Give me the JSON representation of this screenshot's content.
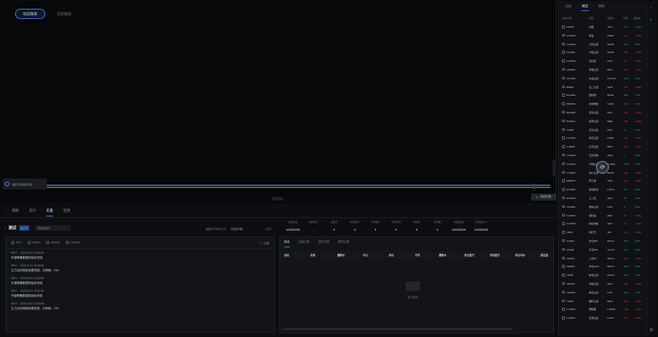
{
  "chart": {
    "tabs": [
      {
        "label": "动态图表",
        "active": true
      },
      {
        "label": "历史图表",
        "active": false
      }
    ],
    "timeline_badge": "最新行情最新时间",
    "collapse_label": "收起列表"
  },
  "bottom": {
    "tabs": [
      "策略",
      "因子",
      "实盘",
      "回测"
    ],
    "active_tab": 2,
    "strategy": {
      "name": "测试",
      "tag": "运行中",
      "select_placeholder": "请选择合约",
      "created": "创建于2026-02-01",
      "stop": "已运行0秒",
      "more": "+ 更多"
    },
    "stats": [
      {
        "k": "当前权益",
        "v": "10000000"
      },
      {
        "k": "最新盈亏",
        "v": "-"
      },
      {
        "k": "总盈亏",
        "v": "0"
      },
      {
        "k": "持仓盈亏",
        "v": "0"
      },
      {
        "k": "平仓盈亏",
        "v": "0"
      },
      {
        "k": "总手续费",
        "v": "0"
      },
      {
        "k": "手续费",
        "v": "0"
      },
      {
        "k": "总手数",
        "v": "0"
      },
      {
        "k": "初始权益",
        "v": "10000000"
      },
      {
        "k": "可用资金 ⊙",
        "v": "10000000"
      }
    ]
  },
  "log": {
    "filters": [
      "INFO",
      "WARN",
      "DEBUG",
      "ERROR"
    ],
    "clear_label": "清除",
    "items": [
      {
        "level": "INFO",
        "time": "2026-02-01 22:46:55",
        "msg": "外部策略数据初始化完成"
      },
      {
        "level": "INFO",
        "time": "2026-02-01 22:46:55",
        "msg": "主力合约映射加载完成，已映射：243"
      },
      {
        "level": "INFO",
        "time": "2026-02-01 22:46:55",
        "msg": "外部策略数据初始化完成"
      },
      {
        "level": "INFO",
        "time": "2026-02-01 22:40:56",
        "msg": "外部策略数据初始化完成"
      },
      {
        "level": "INFO",
        "time": "2026-02-01 22:40:56",
        "msg": "主力合约映射加载完成，已映射：243"
      }
    ]
  },
  "positions": {
    "tabs": [
      "持仓",
      "当前订单",
      "成交记录",
      "委托记录"
    ],
    "headers": [
      "合约",
      "买卖",
      "最新价",
      "今仓",
      "持仓",
      "可平",
      "最新价",
      "持仓盈亏",
      "浮动盈亏",
      "持仓均价",
      "保证金"
    ],
    "empty_text": "暂无数据"
  },
  "watchlist": {
    "tabs": [
      "自选",
      "期货",
      "期权"
    ],
    "active_tab": 1,
    "headers": [
      "合约代码",
      "名称",
      "最新价",
      "涨跌",
      "涨跌幅"
    ],
    "rows": [
      {
        "code": "AG603",
        "name": "白银",
        "price": "4374",
        "chg": "-12",
        "pct": "-0.3%",
        "dir": "down"
      },
      {
        "code": "AG2603",
        "name": "黄金",
        "price": "23000",
        "chg": "-11",
        "pct": "-0.5%",
        "dir": "up"
      },
      {
        "code": "AG2604",
        "name": "沪锌主连",
        "price": "29195",
        "chg": "154",
        "pct": "0.5%",
        "dir": "down"
      },
      {
        "code": "AL2603",
        "name": "沪铝主连",
        "price": "24325",
        "chg": "-35",
        "pct": "-0.1%",
        "dir": "up"
      },
      {
        "code": "AO2605",
        "name": "氧化铝",
        "price": "2752",
        "chg": "-3",
        "pct": "-0.1%",
        "dir": "up"
      },
      {
        "code": "AP2605",
        "name": "苹果主连",
        "price": "9594",
        "chg": "-65",
        "pct": "-0.7%",
        "dir": "up"
      },
      {
        "code": "AU2604",
        "name": "沪金主连",
        "price": "1142.02",
        "chg": "2.62",
        "pct": "0.2%",
        "dir": "down"
      },
      {
        "code": "B2603",
        "name": "豆二主连",
        "price": "3346",
        "chg": "-15",
        "pct": "-0.5%",
        "dir": "up"
      },
      {
        "code": "BC2603",
        "name": "国际铜",
        "price": "89190",
        "chg": "890",
        "pct": "1.0%",
        "dir": "down"
      },
      {
        "code": "BR2603",
        "name": "合成橡胶",
        "price": "12940",
        "chg": "170",
        "pct": "1.3%",
        "dir": "down"
      },
      {
        "code": "BU2603",
        "name": "沥青主连",
        "price": "3222",
        "chg": "-41",
        "pct": "-1.2%",
        "dir": "up"
      },
      {
        "code": "BZ2603",
        "name": "纯苯主连",
        "price": "5985",
        "chg": "-28",
        "pct": "-0.5%",
        "dir": "up"
      },
      {
        "code": "C2603",
        "name": "玉米主连",
        "price": "2284",
        "chg": "2",
        "pct": "0.1%",
        "dir": "down"
      },
      {
        "code": "CF2605",
        "name": "棉花主连",
        "price": "14605",
        "chg": "-95",
        "pct": "-0.6%",
        "dir": "up"
      },
      {
        "code": "CJ2605",
        "name": "红枣主连",
        "price": "8820",
        "chg": "-20",
        "pct": "-0.2%",
        "dir": "up"
      },
      {
        "code": "CS2603",
        "name": "玉米淀粉",
        "price": "2539",
        "chg": "7",
        "pct": "0.3%",
        "dir": "down"
      },
      {
        "code": "CU2603",
        "name": "沪铜主连",
        "price": "101000",
        "chg": "1170",
        "pct": "1.1%",
        "dir": "down"
      },
      {
        "code": "CY2605",
        "name": "棉纱主连",
        "price": "20035",
        "chg": "-40",
        "pct": "-0.2%",
        "dir": "up"
      },
      {
        "code": "EB2603",
        "name": "苯乙烯",
        "price": "7600",
        "chg": "-13",
        "pct": "-0.2%",
        "dir": "up"
      },
      {
        "code": "EC2604",
        "name": "欧线集运",
        "price": "1763.9",
        "chg": "6.5",
        "pct": "0.4%",
        "dir": "down"
      },
      {
        "code": "EG2605",
        "name": "乙二醇",
        "price": "3942",
        "chg": "14",
        "pct": "0.4%",
        "dir": "down"
      },
      {
        "code": "FG2605",
        "name": "玻璃主连",
        "price": "1020",
        "chg": "2",
        "pct": "0.2%",
        "dir": "down"
      },
      {
        "code": "FU2605",
        "name": "燃料油",
        "price": "2696",
        "chg": "-5",
        "pct": "-0.2%",
        "dir": "up"
      },
      {
        "code": "HC2605",
        "name": "热轧卷板",
        "price": "3297",
        "chg": "-9",
        "pct": "-0.3%",
        "dir": "up"
      },
      {
        "code": "I2605",
        "name": "铁矿石",
        "price": "786",
        "chg": "-2.5",
        "pct": "-0.3%",
        "dir": "up"
      },
      {
        "code": "IC2603",
        "name": "中证500",
        "price": "8334.2",
        "chg": "40.6",
        "pct": "0.5%",
        "dir": "down"
      },
      {
        "code": "IF2603",
        "name": "沪深300",
        "price": "4714.8",
        "chg": "7.8",
        "pct": "0.2%",
        "dir": "down"
      },
      {
        "code": "IH2603",
        "name": "上证50",
        "price": "3042.2",
        "chg": "-9.2",
        "pct": "-0.3%",
        "dir": "up"
      },
      {
        "code": "IM2603",
        "name": "中证1000",
        "price": "8303.4",
        "chg": "32.8",
        "pct": "0.4%",
        "dir": "down"
      },
      {
        "code": "J2605",
        "name": "焦炭主连",
        "price": "1664.5",
        "chg": "21.5",
        "pct": "1.3%",
        "dir": "down"
      },
      {
        "code": "JD2603",
        "name": "鸡蛋主连",
        "price": "3047",
        "chg": "-28",
        "pct": "-0.9%",
        "dir": "up"
      },
      {
        "code": "JM2605",
        "name": "焦煤主连",
        "price": "1176",
        "chg": "19.5",
        "pct": "1.7%",
        "dir": "down"
      },
      {
        "code": "L2605",
        "name": "塑料主连",
        "price": "6650",
        "chg": "-20",
        "pct": "-0.3%",
        "dir": "up"
      },
      {
        "code": "LC2605",
        "name": "碳酸锂",
        "price": "178400",
        "chg": "-460",
        "pct": "-0.3%",
        "dir": "up"
      },
      {
        "code": "LH2603",
        "name": "生猪主连",
        "price": "11475",
        "chg": "-30",
        "pct": "-0.3%",
        "dir": "up"
      }
    ]
  },
  "colors": {
    "accent": "#3b6fd8",
    "up": "#e0474c",
    "down": "#21b88a"
  },
  "toolbar_icons": [
    "minus-icon",
    "plus-icon",
    "settings-icon"
  ]
}
